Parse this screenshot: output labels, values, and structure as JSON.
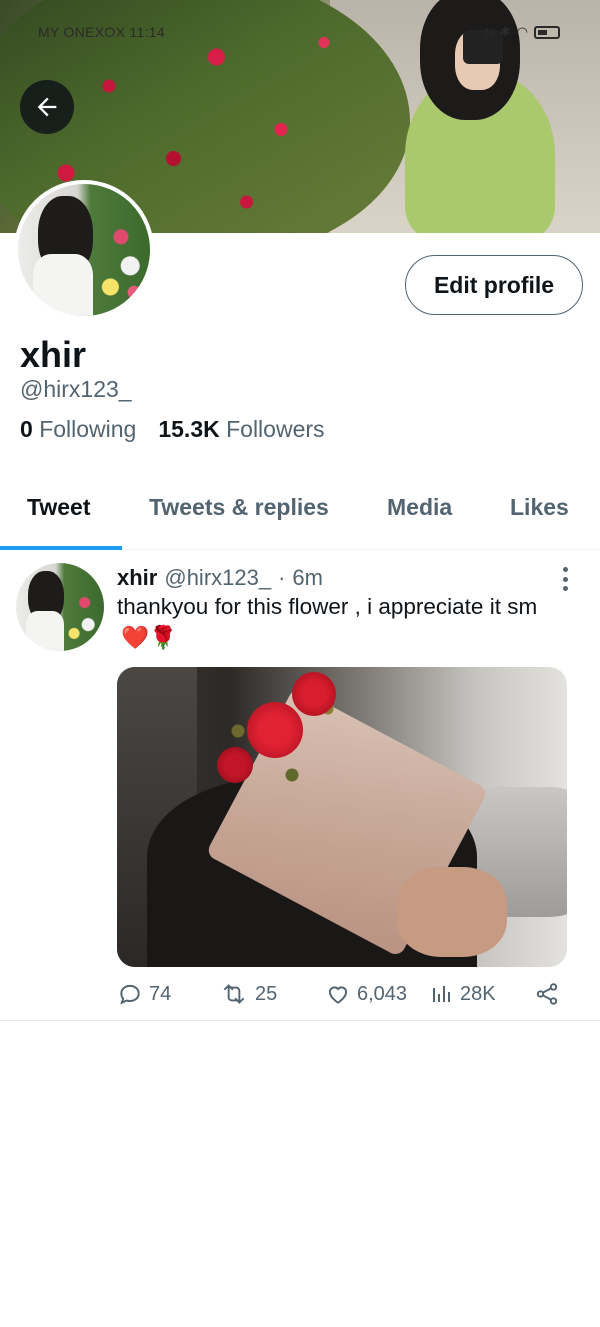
{
  "status_bar": {
    "carrier_time": "MY ONEXOX 11:14",
    "battery_icon": "battery-icon",
    "wifi_icon": "wifi-icon",
    "bluetooth_icon": "bluetooth-icon",
    "nfc_icon": "nfc-icon"
  },
  "header": {
    "back_icon": "arrow-left-icon"
  },
  "profile": {
    "edit_label": "Edit profile",
    "display_name": "xhir",
    "handle": "@hirx123_",
    "following_count": "0",
    "following_label": "Following",
    "followers_count": "15.3K",
    "followers_label": "Followers"
  },
  "tabs": [
    {
      "label": "Tweet",
      "active": true
    },
    {
      "label": "Tweets & replies",
      "active": false
    },
    {
      "label": "Media",
      "active": false
    },
    {
      "label": "Likes",
      "active": false
    }
  ],
  "tweet": {
    "name": "xhir",
    "handle": "@hirx123_",
    "dot": "·",
    "time": "6m",
    "text": "thankyou for this flower , i appreciate it sm",
    "emojis": "❤️🌹",
    "replies": "74",
    "retweets": "25",
    "likes": "6,043",
    "views": "28K"
  },
  "colors": {
    "accent": "#1d9bf0",
    "text_primary": "#0f1419",
    "text_secondary": "#536471"
  }
}
